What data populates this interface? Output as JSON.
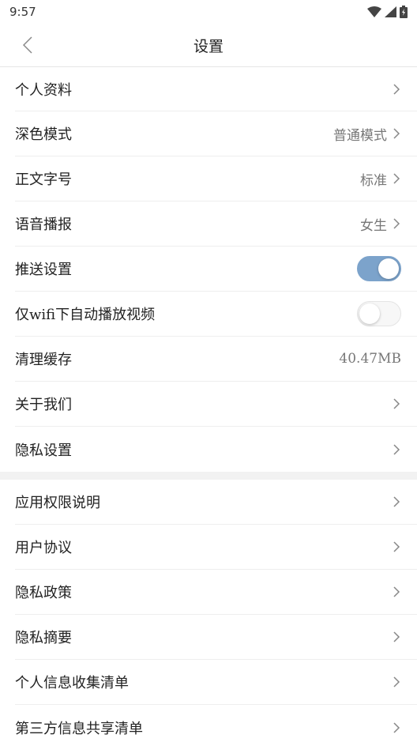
{
  "status_bar": {
    "time": "9:57"
  },
  "nav": {
    "title": "设置"
  },
  "section1": [
    {
      "label": "个人资料",
      "value": "",
      "type": "link"
    },
    {
      "label": "深色模式",
      "value": "普通模式",
      "type": "link"
    },
    {
      "label": "正文字号",
      "value": "标准",
      "type": "link"
    },
    {
      "label": "语音播报",
      "value": "女生",
      "type": "link"
    },
    {
      "label": "推送设置",
      "type": "toggle",
      "on": true
    },
    {
      "label": "仅wifi下自动播放视频",
      "type": "toggle",
      "on": false
    },
    {
      "label": "清理缓存",
      "value": "40.47MB",
      "type": "value"
    },
    {
      "label": "关于我们",
      "value": "",
      "type": "link"
    },
    {
      "label": "隐私设置",
      "value": "",
      "type": "link"
    }
  ],
  "section2": [
    {
      "label": "应用权限说明"
    },
    {
      "label": "用户协议"
    },
    {
      "label": "隐私政策"
    },
    {
      "label": "隐私摘要"
    },
    {
      "label": "个人信息收集清单"
    },
    {
      "label": "第三方信息共享清单"
    }
  ],
  "colors": {
    "toggle_on": "#7ca3cb",
    "divider": "#eeeeee",
    "section_gap": "#f2f2f2"
  }
}
